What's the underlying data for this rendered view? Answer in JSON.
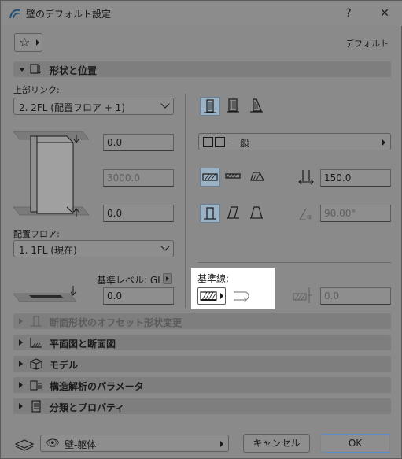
{
  "window": {
    "title": "壁のデフォルト設定",
    "help_label": "?",
    "close_label": "✕"
  },
  "toolbar": {
    "favorites_icon": "star-icon",
    "default_label": "デフォルト"
  },
  "sections": {
    "geometry": {
      "label": "形状と位置",
      "expanded": true
    },
    "profile_offset": {
      "label": "断面形状のオフセット形状変更",
      "enabled": false
    },
    "plan_section": {
      "label": "平面図と断面図"
    },
    "model": {
      "label": "モデル"
    },
    "structural": {
      "label": "構造解析のパラメータ"
    },
    "classification": {
      "label": "分類とプロパティ"
    }
  },
  "geometry": {
    "top_link_label": "上部リンク:",
    "top_link_value": "2. 2FL (配置フロア + 1)",
    "top_offset": "0.0",
    "height": "3000.0",
    "bottom_offset": "0.0",
    "home_story_label": "配置フロア:",
    "home_story_value": "1. 1FL (現在)",
    "ref_level_label": "基準レベル: GL",
    "ref_level_value": "0.0",
    "structure_value": "一般",
    "thickness": "150.0",
    "slant_angle": "90.00°",
    "reference_line_label": "基準線:",
    "ref_offset": "0.0"
  },
  "footer": {
    "layer_value": "壁-躯体",
    "cancel_label": "キャンセル",
    "ok_label": "OK"
  },
  "colors": {
    "background": "#8a8a8a",
    "selected_toggle": "#9bb1c4",
    "highlight": "#ffffff",
    "ok_border": "#5a8cc8"
  }
}
